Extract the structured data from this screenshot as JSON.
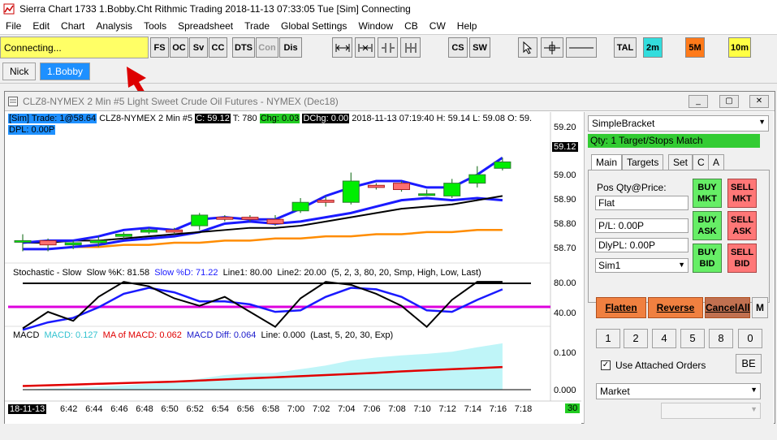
{
  "window": {
    "title": "Sierra Chart 1733 1.Bobby.Cht  Rithmic Trading 2018-11-13  07:33:05 Tue [Sim]  Connecting"
  },
  "menu": [
    "File",
    "Edit",
    "Chart",
    "Analysis",
    "Tools",
    "Spreadsheet",
    "Trade",
    "Global Settings",
    "Window",
    "CB",
    "CW",
    "Help"
  ],
  "toolbar": {
    "status": "Connecting...",
    "buttons": [
      "FS",
      "OC",
      "Sv",
      "CC",
      "DTS",
      "Con",
      "Dis",
      "CS",
      "SW",
      "TAL",
      "2m",
      "5M",
      "10m"
    ]
  },
  "tabs": [
    "Nick",
    "1.Bobby"
  ],
  "chart_window": {
    "title": "CLZ8-NYMEX  2 Min  #5  Light Sweet Crude Oil Futures - NYMEX (Dec18)"
  },
  "info": {
    "sim": "[Sim]  Trade: 1@58.64",
    "symbol": "CLZ8-NYMEX  2 Min  #5",
    "close": "C: 59.12",
    "trades": "T: 780",
    "chg": "Chg: 0.03",
    "dchg": "DChg: 0.00",
    "ohlc": "2018-11-13 07:19:40 H: 59.14 L: 59.08 O: 59.",
    "dpl": "DPL: 0.00P"
  },
  "stoch": {
    "name": "Stochastic - Slow",
    "k": "Slow %K: 81.58",
    "d": "Slow %D: 71.22",
    "line1": "Line1: 80.00",
    "line2": "Line2: 20.00",
    "params": "(5, 2, 3, 80, 20, Smp, High, Low, Last)",
    "y_high": "80.00",
    "y_low": "40.00"
  },
  "macd": {
    "name": "MACD",
    "macd": "MACD: 0.127",
    "ma": "MA of MACD: 0.062",
    "diff": "MACD Diff: 0.064",
    "line": "Line: 0.000",
    "params": "(Last, 5, 20, 30, Exp)",
    "y_high": "0.100",
    "y_low": "0.000"
  },
  "price_axis": [
    "59.20",
    "59.12",
    "59.00",
    "58.90",
    "58.80",
    "58.70"
  ],
  "x_axis": {
    "date": "18-11-13",
    "times": [
      "6:42",
      "6:44",
      "6:46",
      "6:48",
      "6:50",
      "6:52",
      "6:54",
      "6:56",
      "6:58",
      "7:00",
      "7:02",
      "7:04",
      "7:06",
      "7:08",
      "7:10",
      "7:12",
      "7:14",
      "7:16",
      "7:18"
    ],
    "countdown": "30"
  },
  "trade_panel": {
    "order_type_select": "SimpleBracket",
    "qty_target": "Qty: 1 Target/Stops Match",
    "tabs": [
      "Main",
      "Targets",
      "Set",
      "C",
      "A"
    ],
    "pos_label": "Pos Qty@Price:",
    "pos_value": "Flat",
    "pl": "P/L: 0.00P",
    "dly_pl": "DlyPL: 0.00P",
    "account": "Sim1",
    "buy_mkt": "BUY MKT",
    "sell_mkt": "SELL MKT",
    "buy_ask": "BUY ASK",
    "sell_ask": "SELL ASK",
    "buy_bid": "BUY BID",
    "sell_bid": "SELL BID",
    "flatten": "Flatten",
    "reverse": "Reverse",
    "cancel_all": "CancelAll",
    "m": "M",
    "qty_buttons": [
      "1",
      "2",
      "4",
      "5",
      "8",
      "0"
    ],
    "attached_orders": "Use Attached Orders",
    "be": "BE",
    "order_select": "Market"
  },
  "chart_data": {
    "type": "candlestick",
    "x": [
      "6:40",
      "6:42",
      "6:44",
      "6:46",
      "6:48",
      "6:50",
      "6:52",
      "6:54",
      "6:56",
      "6:58",
      "7:00",
      "7:02",
      "7:04",
      "7:06",
      "7:08",
      "7:10",
      "7:12",
      "7:14",
      "7:16",
      "7:18"
    ],
    "open": [
      58.75,
      58.75,
      58.73,
      58.74,
      58.77,
      58.79,
      58.8,
      58.82,
      58.86,
      58.86,
      58.85,
      58.89,
      58.94,
      58.93,
      59.01,
      59.02,
      58.97,
      58.96,
      59.02,
      59.09
    ],
    "close": [
      58.75,
      58.73,
      58.74,
      58.75,
      58.78,
      58.8,
      58.79,
      58.87,
      58.85,
      58.85,
      58.83,
      58.93,
      58.93,
      59.03,
      59.0,
      58.99,
      58.97,
      59.02,
      59.06,
      59.12
    ],
    "high": [
      58.78,
      58.76,
      58.75,
      58.77,
      58.79,
      58.81,
      58.81,
      58.88,
      58.87,
      58.87,
      58.87,
      58.95,
      58.96,
      59.07,
      59.02,
      59.03,
      58.99,
      59.04,
      59.1,
      59.14
    ],
    "low": [
      58.7,
      58.7,
      58.71,
      58.72,
      58.76,
      58.78,
      58.78,
      58.8,
      58.84,
      58.84,
      58.82,
      58.88,
      58.91,
      58.92,
      58.99,
      58.98,
      58.96,
      58.95,
      59.0,
      59.08
    ],
    "ylim": [
      58.66,
      59.24
    ],
    "upper_band": [
      58.74,
      58.75,
      58.75,
      58.77,
      58.8,
      58.81,
      58.8,
      58.85,
      58.86,
      58.85,
      58.85,
      58.9,
      58.96,
      59.0,
      59.03,
      59.03,
      59.0,
      59.0,
      59.06,
      59.14
    ],
    "lower_band": [
      58.71,
      58.71,
      58.72,
      58.73,
      58.75,
      58.76,
      58.77,
      58.79,
      58.83,
      58.84,
      58.83,
      58.84,
      58.86,
      58.88,
      58.91,
      58.94,
      58.95,
      58.94,
      58.95,
      58.94
    ],
    "ma_black": [
      58.74,
      58.74,
      58.75,
      58.75,
      58.76,
      58.77,
      58.78,
      58.79,
      58.8,
      58.81,
      58.81,
      58.82,
      58.84,
      58.86,
      58.88,
      58.9,
      58.91,
      58.92,
      58.94,
      58.96
    ],
    "ma_orange": [
      58.71,
      58.71,
      58.72,
      58.72,
      58.73,
      58.73,
      58.74,
      58.74,
      58.75,
      58.75,
      58.76,
      58.76,
      58.77,
      58.77,
      58.78,
      58.78,
      58.79,
      58.79,
      58.8,
      58.8
    ],
    "stoch_k": [
      20,
      42,
      30,
      62,
      82,
      76,
      60,
      50,
      62,
      42,
      22,
      60,
      82,
      78,
      66,
      50,
      22,
      58,
      82,
      82
    ],
    "stoch_d": [
      18,
      28,
      34,
      48,
      66,
      74,
      68,
      56,
      56,
      52,
      42,
      44,
      62,
      74,
      72,
      62,
      44,
      42,
      58,
      72
    ],
    "macd_hist": [
      0.0,
      0.003,
      0.005,
      0.008,
      0.012,
      0.016,
      0.02,
      0.03,
      0.04,
      0.045,
      0.046,
      0.056,
      0.066,
      0.08,
      0.088,
      0.094,
      0.098,
      0.104,
      0.116,
      0.127
    ],
    "macd_ma": [
      0.01,
      0.012,
      0.014,
      0.016,
      0.018,
      0.02,
      0.022,
      0.025,
      0.028,
      0.031,
      0.034,
      0.037,
      0.04,
      0.043,
      0.046,
      0.05,
      0.053,
      0.056,
      0.059,
      0.062
    ]
  },
  "colors": {
    "status_yellow": "#ffff66",
    "up_candle": "#00ee00",
    "down_candle": "#ff6f6f",
    "band_blue": "#1a1aff",
    "ma_orange": "#ff8c00",
    "stoch_magenta": "#dd00dd",
    "macd_area": "#bff5f8",
    "macd_ma": "#e00000"
  }
}
